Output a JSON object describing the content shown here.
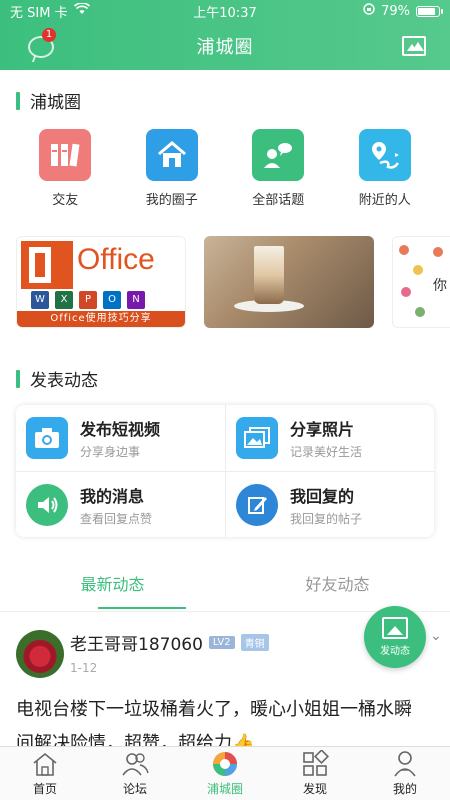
{
  "status_bar": {
    "carrier": "无 SIM 卡",
    "time": "上午10:37",
    "battery": "79%",
    "battery_level": 0.79
  },
  "nav": {
    "title": "浦城圈",
    "chat_badge": "1"
  },
  "circle_section": {
    "title": "浦城圈",
    "items": [
      {
        "label": "交友",
        "icon": "books-icon",
        "color": "#f07b7b"
      },
      {
        "label": "我的圈子",
        "icon": "home-icon",
        "color": "#2e9ee6"
      },
      {
        "label": "全部话题",
        "icon": "chat-people-icon",
        "color": "#3cbf7e"
      },
      {
        "label": "附近的人",
        "icon": "location-route-icon",
        "color": "#33b6e8"
      }
    ]
  },
  "banners": {
    "office": {
      "title": "Office",
      "apps": [
        "W",
        "X",
        "P",
        "O",
        "N"
      ],
      "caption": "Office使用技巧分享"
    },
    "flowers_text": "你"
  },
  "publish_section": {
    "title": "发表动态",
    "items": [
      {
        "title": "发布短视频",
        "subtitle": "分享身边事",
        "icon": "camera-icon",
        "color": "#34a9ec"
      },
      {
        "title": "分享照片",
        "subtitle": "记录美好生活",
        "icon": "photo-icon",
        "color": "#34a9ec"
      },
      {
        "title": "我的消息",
        "subtitle": "查看回复点赞",
        "icon": "speaker-icon",
        "color": "#3cbf7e"
      },
      {
        "title": "我回复的",
        "subtitle": "我回复的帖子",
        "icon": "edit-icon",
        "color": "#2e86d6"
      }
    ]
  },
  "feed_tabs": [
    {
      "label": "最新动态",
      "active": true
    },
    {
      "label": "好友动态",
      "active": false
    }
  ],
  "post": {
    "username": "老王哥哥187060",
    "level": "LV2",
    "rank": "青铜",
    "date": "1-12",
    "text": "电视台楼下一垃圾桶着火了，暖心小姐姐一桶水瞬间解决险情，超赞，超给力👍"
  },
  "fab": {
    "label": "发动态"
  },
  "tab_bar": [
    {
      "label": "首页",
      "icon": "home-outline-icon",
      "active": false
    },
    {
      "label": "论坛",
      "icon": "users-icon",
      "active": false
    },
    {
      "label": "浦城圈",
      "icon": "camera-aperture-icon",
      "active": true
    },
    {
      "label": "发现",
      "icon": "grid-icon",
      "active": false
    },
    {
      "label": "我的",
      "icon": "person-icon",
      "active": false
    }
  ],
  "colors": {
    "brand": "#3cbf7e",
    "badge": "#e0332e"
  }
}
